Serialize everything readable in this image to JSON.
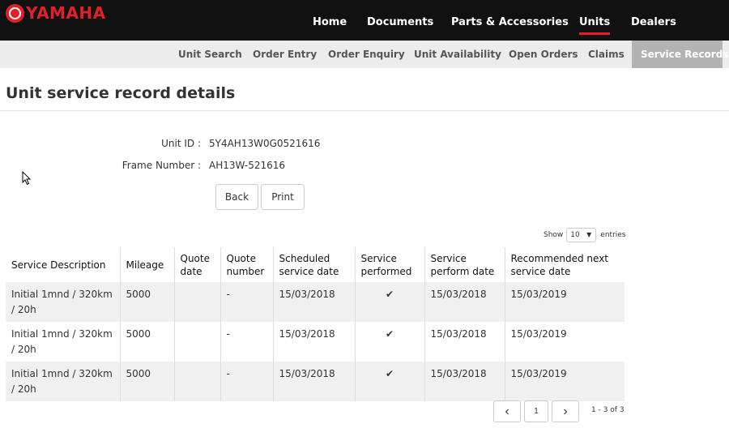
{
  "brand": {
    "name": "YAMAHA",
    "color": "#e0202a",
    "icon": "yamaha-tuning-fork-logo"
  },
  "main_nav": [
    {
      "label": "Home",
      "active": false
    },
    {
      "label": "Documents",
      "active": false
    },
    {
      "label": "Parts & Accessories",
      "active": false
    },
    {
      "label": "Units",
      "active": true
    },
    {
      "label": "Dealers",
      "active": false
    }
  ],
  "sub_nav": [
    {
      "label": "Unit Search",
      "active": false
    },
    {
      "label": "Order Entry",
      "active": false
    },
    {
      "label": "Order Enquiry",
      "active": false
    },
    {
      "label": "Unit Availability",
      "active": false
    },
    {
      "label": "Open Orders",
      "active": false
    },
    {
      "label": "Claims",
      "active": false
    },
    {
      "label": "Service Records",
      "active": true
    }
  ],
  "page": {
    "title": "Unit service record details"
  },
  "details": {
    "unit_id_label": "Unit ID :",
    "unit_id_value": "5Y4AH13W0G0521616",
    "frame_label": "Frame Number :",
    "frame_value": "AH13W-521616"
  },
  "actions": {
    "back_label": "Back",
    "print_label": "Print"
  },
  "table_controls": {
    "show_label": "Show",
    "page_size": "10",
    "entries_label": "entries"
  },
  "table": {
    "headers": [
      "Service Description",
      "Mileage",
      "Quote date",
      "Quote number",
      "Scheduled service date",
      "Service performed",
      "Service perform date",
      "Recommended next service date"
    ],
    "rows": [
      {
        "description": "Initial 1mnd / 320km / 20h",
        "mileage": "5000",
        "quote_date": "",
        "quote_number": "-",
        "scheduled": "15/03/2018",
        "performed": "✔",
        "perform_date": "15/03/2018",
        "next_date": "15/03/2019"
      },
      {
        "description": "Initial 1mnd / 320km / 20h",
        "mileage": "5000",
        "quote_date": "",
        "quote_number": "-",
        "scheduled": "15/03/2018",
        "performed": "✔",
        "perform_date": "15/03/2018",
        "next_date": "15/03/2019"
      },
      {
        "description": "Initial 1mnd / 320km / 20h",
        "mileage": "5000",
        "quote_date": "",
        "quote_number": "-",
        "scheduled": "15/03/2018",
        "performed": "✔",
        "perform_date": "15/03/2018",
        "next_date": "15/03/2019"
      }
    ]
  },
  "pagination": {
    "prev_icon": "‹",
    "current_page": "1",
    "next_icon": "›",
    "info": "1 - 3 of 3"
  },
  "colors": {
    "accent": "#e0202a",
    "topbar": "#111111",
    "subnav": "#ececec",
    "subnav_active": "#b3b3b3"
  }
}
